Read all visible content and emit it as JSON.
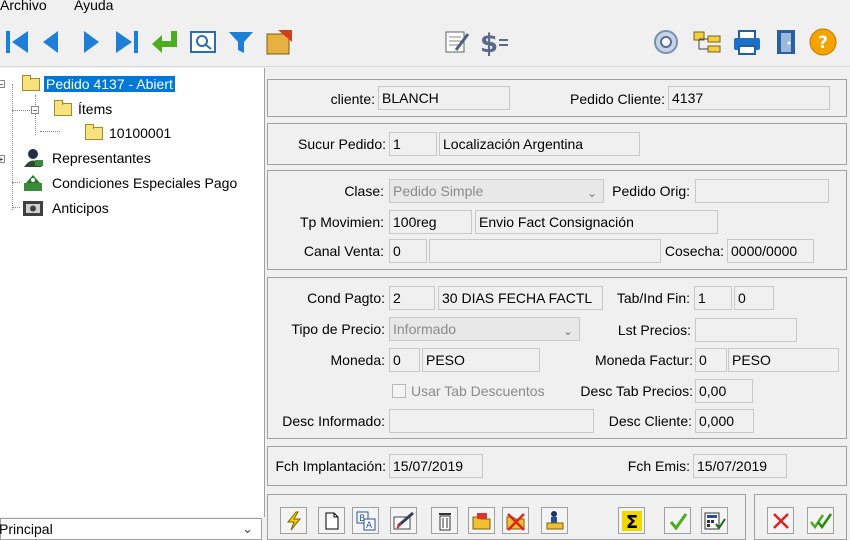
{
  "menu": {
    "file": "Archivo",
    "help": "Ayuda"
  },
  "tree": {
    "root": "Pedido 4137 - Abiert",
    "items": "Ítems",
    "item_code": "10100001",
    "reps": "Representantes",
    "cond": "Condiciones Especiales Pago",
    "anticipos": "Anticipos"
  },
  "combo": {
    "value": "Principal"
  },
  "header": {
    "cliente_label": "cliente:",
    "cliente_value": "BLANCH",
    "pedido_cliente_label": "Pedido Cliente:",
    "pedido_cliente_value": "4137"
  },
  "sucursal": {
    "label": "Sucur Pedido:",
    "code": "1",
    "name": "Localización Argentina"
  },
  "tipo": {
    "clase_label": "Clase:",
    "clase_value": "Pedido Simple",
    "pedido_orig_label": "Pedido Orig:",
    "pedido_orig_value": "",
    "tp_mov_label": "Tp Movimien:",
    "tp_mov_code": "100reg",
    "tp_mov_name": "Envio Fact Consignación",
    "canal_label": "Canal Venta:",
    "canal_code": "0",
    "canal_name": "",
    "cosecha_label": "Cosecha:",
    "cosecha_value": "0000/0000"
  },
  "pago": {
    "cond_label": "Cond Pagto:",
    "cond_code": "2",
    "cond_name": "30 DIAS FECHA FACTL",
    "tab_label": "Tab/Ind Fin:",
    "tab_value": "1",
    "ind_value": "0",
    "tipo_precio_label": "Tipo de Precio:",
    "tipo_precio_value": "Informado",
    "lst_label": "Lst Precios:",
    "lst_value": "",
    "moneda_label": "Moneda:",
    "moneda_code": "0",
    "moneda_name": "PESO",
    "moneda_fact_label": "Moneda Factur:",
    "moneda_fact_code": "0",
    "moneda_fact_name": "PESO",
    "usar_tab_label": "Usar Tab Descuentos",
    "desc_tab_label": "Desc Tab Precios:",
    "desc_tab_value": "0,00",
    "desc_inf_label": "Desc Informado:",
    "desc_inf_value": "",
    "desc_cli_label": "Desc Cliente:",
    "desc_cli_value": "0,000"
  },
  "fechas": {
    "impl_label": "Fch Implantación:",
    "impl_value": "15/07/2019",
    "emis_label": "Fch Emis:",
    "emis_value": "15/07/2019"
  },
  "colors": {
    "selection": "#0078d7",
    "nav_blue": "#1e7fd8",
    "help_orange": "#f4a300"
  }
}
